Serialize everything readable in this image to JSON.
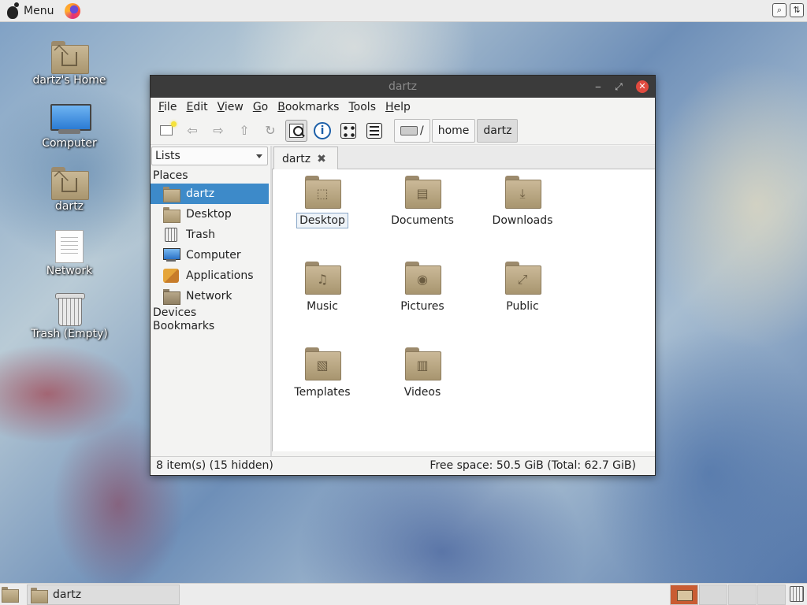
{
  "top_panel": {
    "menu_label": "Menu",
    "icons": [
      "gnome-icon",
      "firefox-icon",
      "search-tray-icon",
      "network-tray-icon"
    ]
  },
  "desktop": {
    "icons": [
      {
        "label": "dartz's Home",
        "icon": "home-folder-icon"
      },
      {
        "label": "Computer",
        "icon": "computer-icon"
      },
      {
        "label": "dartz",
        "icon": "home-folder-icon"
      },
      {
        "label": "Network",
        "icon": "document-icon"
      },
      {
        "label": "Trash (Empty)",
        "icon": "trash-icon"
      }
    ]
  },
  "window": {
    "title": "dartz",
    "buttons": {
      "minimize": "‒",
      "maximize": "⤢",
      "close": "✕"
    },
    "menubar": [
      {
        "u": "F",
        "rest": "ile"
      },
      {
        "u": "E",
        "rest": "dit"
      },
      {
        "u": "V",
        "rest": "iew"
      },
      {
        "u": "G",
        "rest": "o"
      },
      {
        "u": "B",
        "rest": "ookmarks"
      },
      {
        "u": "T",
        "rest": "ools"
      },
      {
        "u": "H",
        "rest": "elp"
      }
    ],
    "toolbar": {
      "back_glyph": "⇦",
      "forward_glyph": "⇨",
      "up_glyph": "⇧",
      "reload_glyph": "↻",
      "info_glyph": "i"
    },
    "path": {
      "root": "/",
      "segments": [
        "home",
        "dartz"
      ]
    },
    "sidebar": {
      "mode": "Lists",
      "places_heading": "Places",
      "places": [
        {
          "label": "dartz",
          "icon": "home-folder-icon",
          "selected": true
        },
        {
          "label": "Desktop",
          "icon": "desktop-folder-icon",
          "selected": false
        },
        {
          "label": "Trash",
          "icon": "trash-icon",
          "selected": false
        },
        {
          "label": "Computer",
          "icon": "computer-icon",
          "selected": false
        },
        {
          "label": "Applications",
          "icon": "applications-icon",
          "selected": false
        },
        {
          "label": "Network",
          "icon": "network-folder-icon",
          "selected": false
        }
      ],
      "devices_heading": "Devices",
      "bookmarks_heading": "Bookmarks"
    },
    "tab": {
      "label": "dartz",
      "close_glyph": "✖"
    },
    "files": [
      {
        "label": "Desktop",
        "glyph": "⬚",
        "icon": "desktop-folder-icon"
      },
      {
        "label": "Documents",
        "glyph": "▤",
        "icon": "documents-folder-icon"
      },
      {
        "label": "Downloads",
        "glyph": "⤓",
        "icon": "downloads-folder-icon"
      },
      {
        "label": "Music",
        "glyph": "♫",
        "icon": "music-folder-icon"
      },
      {
        "label": "Pictures",
        "glyph": "◉",
        "icon": "pictures-folder-icon"
      },
      {
        "label": "Public",
        "glyph": "⤢",
        "icon": "public-folder-icon"
      },
      {
        "label": "Templates",
        "glyph": "▧",
        "icon": "templates-folder-icon"
      },
      {
        "label": "Videos",
        "glyph": "▥",
        "icon": "videos-folder-icon"
      }
    ],
    "status": {
      "items": "8 item(s) (15 hidden)",
      "space": "Free space: 50.5 GiB (Total: 62.7 GiB)"
    }
  },
  "bottom_panel": {
    "task_label": "dartz",
    "workspaces": 4,
    "active_workspace": 1
  },
  "colors": {
    "selection": "#3d8ac9",
    "titlebar": "#3b3b3b",
    "close_button": "#e04a3f",
    "active_workspace": "#c95c33"
  }
}
